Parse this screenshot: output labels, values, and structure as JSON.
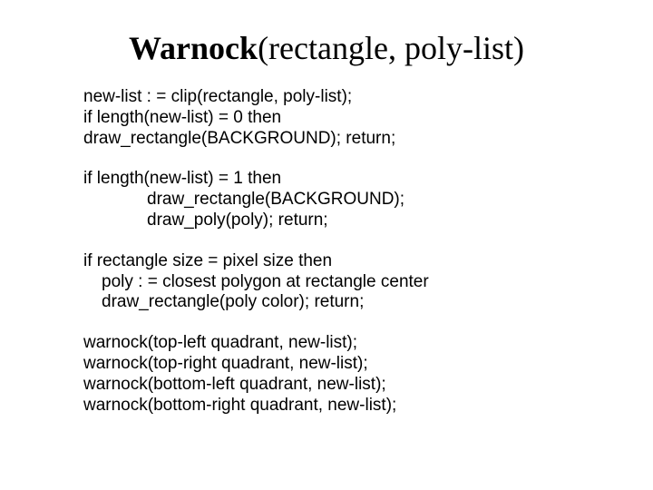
{
  "title_bold": "Warnock",
  "title_rest": "(rectangle, poly-list)",
  "block1": {
    "l1": "new-list : = clip(rectangle, poly-list);",
    "l2": "if length(new-list) = 0 then",
    "l3": "draw_rectangle(BACKGROUND); return;"
  },
  "block2": {
    "l1": "if length(new-list) = 1 then",
    "l2": "draw_rectangle(BACKGROUND);",
    "l3": "draw_poly(poly); return;"
  },
  "block3": {
    "l1": "if rectangle size = pixel size then",
    "l2": "poly : = closest polygon at rectangle center",
    "l3": "draw_rectangle(poly color); return;"
  },
  "block4": {
    "l1": "warnock(top-left quadrant, new-list);",
    "l2": "warnock(top-right quadrant, new-list);",
    "l3": "warnock(bottom-left quadrant, new-list);",
    "l4": "warnock(bottom-right quadrant, new-list);"
  }
}
